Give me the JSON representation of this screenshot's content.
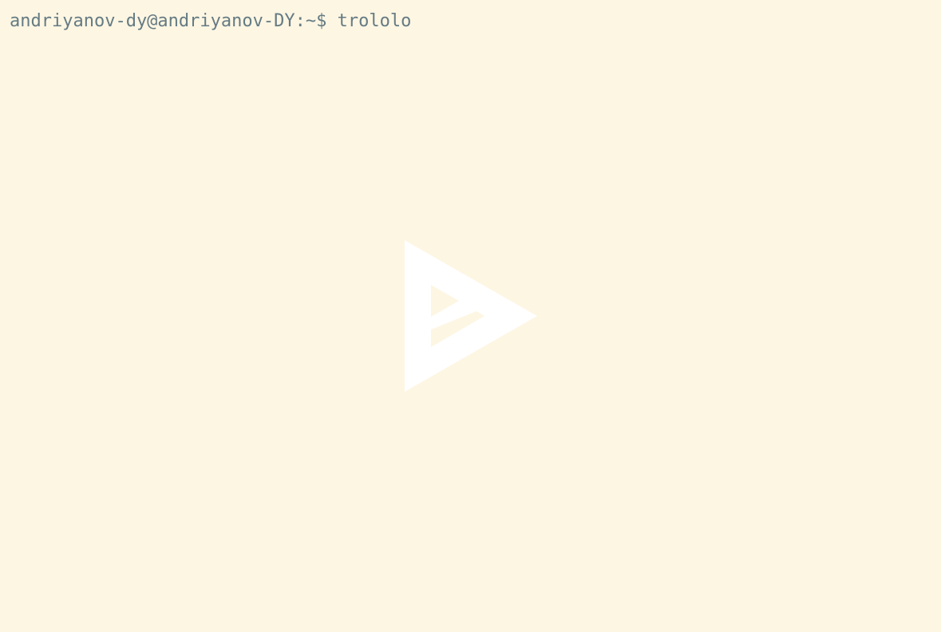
{
  "terminal": {
    "prompt": "andriyanov-dy@andriyanov-DY:~$ ",
    "command": "trololo",
    "background_color": "#fdf6e3",
    "text_color": "#657b83"
  },
  "player": {
    "play_icon": "asciinema-play-icon",
    "icon_color": "#ffffff"
  }
}
